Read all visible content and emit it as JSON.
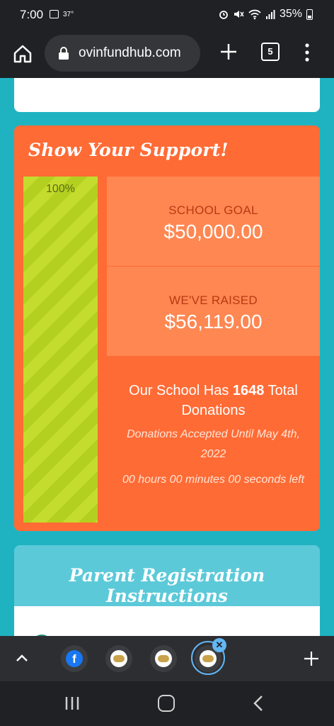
{
  "status_bar": {
    "time": "7:00",
    "temperature": "37°",
    "battery": "35%"
  },
  "browser": {
    "url": "ovinfundhub.com",
    "tab_count": "5"
  },
  "support": {
    "title": "Show Your Support!",
    "progress_label": "100%",
    "progress_fraction": 1.0,
    "goal_label": "SCHOOL GOAL",
    "goal_value": "$50,000.00",
    "raised_label": "WE'VE RAISED",
    "raised_value": "$56,119.00",
    "donations_prefix": "Our School Has",
    "donations_count": "1648",
    "donations_suffix": "Total Donations",
    "deadline": "Donations Accepted Until May 4th, 2022",
    "countdown": "00 hours 00 minutes 00 seconds left"
  },
  "parent": {
    "title": "Parent Registration Instructions"
  },
  "tab_strip": {
    "tabs": [
      {
        "icon": "facebook-icon",
        "label": "f"
      },
      {
        "icon": "site-favicon-icon"
      },
      {
        "icon": "site-favicon-icon"
      },
      {
        "icon": "site-favicon-icon",
        "active": true
      }
    ]
  },
  "colors": {
    "page_bg": "#1fb3c2",
    "support_card": "#ff6b35",
    "stat_box": "#ff8752",
    "progress_green": "#c4dc2e",
    "label_dark_orange": "#b83a12",
    "parent_card": "#5cc9d9"
  }
}
